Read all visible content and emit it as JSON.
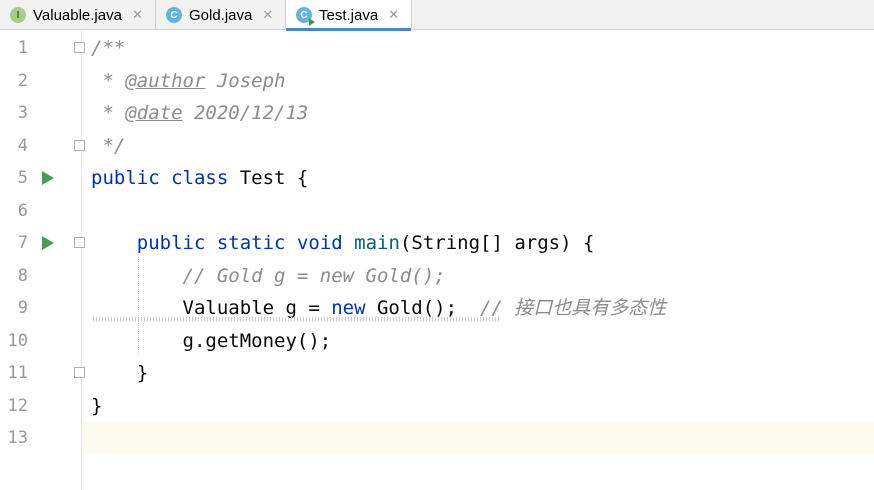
{
  "tabs": [
    {
      "label": "Valuable.java",
      "icon": "interface-icon",
      "icon_letter": "I",
      "close": "✕",
      "active": false
    },
    {
      "label": "Gold.java",
      "icon": "class-icon",
      "icon_letter": "C",
      "close": "✕",
      "active": false
    },
    {
      "label": "Test.java",
      "icon": "runnable-class-icon",
      "icon_letter": "C",
      "close": "✕",
      "active": true
    }
  ],
  "editor": {
    "current_line": 13,
    "lines": [
      {
        "n": "1",
        "tokens": [
          {
            "t": "/**",
            "c": "cm"
          }
        ]
      },
      {
        "n": "2",
        "tokens": [
          {
            "t": " * ",
            "c": "cm"
          },
          {
            "t": "@author",
            "c": "tag"
          },
          {
            "t": " Joseph",
            "c": "cm"
          }
        ]
      },
      {
        "n": "3",
        "tokens": [
          {
            "t": " * ",
            "c": "cm"
          },
          {
            "t": "@date",
            "c": "tag"
          },
          {
            "t": " 2020/12/13",
            "c": "cm"
          }
        ]
      },
      {
        "n": "4",
        "tokens": [
          {
            "t": " */",
            "c": "cm"
          }
        ]
      },
      {
        "n": "5",
        "tokens": [
          {
            "t": "public",
            "c": "kw"
          },
          {
            "t": " ",
            "c": ""
          },
          {
            "t": "class",
            "c": "kw"
          },
          {
            "t": " Test {",
            "c": ""
          }
        ]
      },
      {
        "n": "6",
        "tokens": []
      },
      {
        "n": "7",
        "tokens": [
          {
            "t": "    ",
            "c": ""
          },
          {
            "t": "public",
            "c": "kw"
          },
          {
            "t": " ",
            "c": ""
          },
          {
            "t": "static",
            "c": "kw"
          },
          {
            "t": " ",
            "c": ""
          },
          {
            "t": "void",
            "c": "kw"
          },
          {
            "t": " ",
            "c": ""
          },
          {
            "t": "main",
            "c": "fn"
          },
          {
            "t": "(String[] args) {",
            "c": ""
          }
        ]
      },
      {
        "n": "8",
        "tokens": [
          {
            "t": "        ",
            "c": ""
          },
          {
            "t": "// Gold g = new Gold();",
            "c": "cm"
          }
        ]
      },
      {
        "n": "9",
        "tokens": [
          {
            "t": "        Valuable g = ",
            "c": ""
          },
          {
            "t": "new",
            "c": "kw"
          },
          {
            "t": " Gold();  ",
            "c": ""
          },
          {
            "t": "// 接口也具有多态性",
            "c": "cm"
          }
        ]
      },
      {
        "n": "10",
        "tokens": [
          {
            "t": "        g.getMoney();",
            "c": ""
          }
        ]
      },
      {
        "n": "11",
        "tokens": [
          {
            "t": "    }",
            "c": ""
          }
        ]
      },
      {
        "n": "12",
        "tokens": [
          {
            "t": "}",
            "c": ""
          }
        ]
      },
      {
        "n": "13",
        "tokens": []
      }
    ],
    "run_markers": [
      5,
      7
    ],
    "fold_markers": [
      1,
      4,
      7,
      11
    ]
  }
}
